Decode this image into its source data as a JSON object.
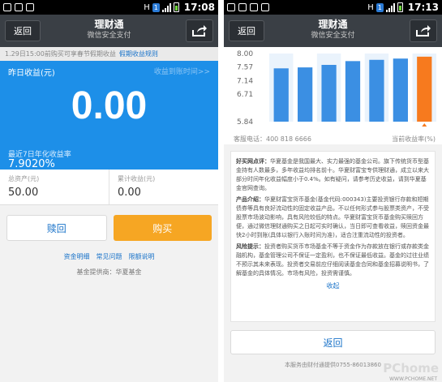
{
  "left": {
    "status": {
      "time": "17:08",
      "net": "H"
    },
    "nav": {
      "back_label": "返回",
      "title": "理财通",
      "subtitle": "微信安全支付"
    },
    "notice": {
      "text": "1.29日15:00前购买可享春节假期收益",
      "link": "假期收益规则"
    },
    "earnings": {
      "yesterday_label": "昨日收益(元)",
      "history_link": "收益到账时间>>",
      "yesterday_value": "0.00",
      "rate_label": "最近7日年化收益率",
      "rate_value": "7.9020%"
    },
    "assets": [
      {
        "label": "总资产(元)",
        "value": "50.00"
      },
      {
        "label": "累计收益(元)",
        "value": "0.00"
      }
    ],
    "buttons": {
      "redeem": "赎回",
      "buy": "购买"
    },
    "links": [
      "资金明细",
      "常见问题",
      "限额说明"
    ],
    "provider": "基金提供商：华夏基金"
  },
  "right": {
    "status": {
      "time": "17:13",
      "net": "H"
    },
    "nav": {
      "back_label": "返回",
      "title": "理财通",
      "subtitle": "微信安全支付"
    },
    "chart_data": {
      "type": "bar",
      "categories": [
        "",
        "",
        "",
        "",
        "",
        "",
        ""
      ],
      "values": [
        7.53,
        7.56,
        7.64,
        7.76,
        7.8,
        7.84,
        7.9
      ],
      "ylim": [
        5.84,
        8.0
      ],
      "yticks": [
        "8.00",
        "7.57",
        "7.14",
        "6.71",
        "5.84"
      ],
      "highlight_index": 6,
      "colors": {
        "bar": "#3b8fe3",
        "highlight": "#f77a1e",
        "stripe": "#eaf3fc"
      }
    },
    "chart_footer": {
      "phone": "客服电话：400 818 6666",
      "current": "当前收益率(%)"
    },
    "info": [
      {
        "label": "好买网点评：",
        "text": "华夏基金是我国最大、实力最强的基金公司。旗下传统货币型基金持有人数最多，多年收益均排名前十。华夏财富宝专供理财通，成立以来大部分时间年化收益幅度小于0.4%。如有疑问，请参考历史收益，请到华夏基金官网查询。"
      },
      {
        "label": "产品介绍：",
        "text": "华夏财富宝货币基金(基金代码:000343)主要投资银行存款和短期债券等具有良好流动性的固定收益产品，不以任何形式参与股票类资产，不受股票市场波动影响，具有风险较低的特点。华夏财富宝货币基金购买赎回方便，通过微信理财通购买之日起可实时确认，当日即可查看收益，赎回资金最快2小时到账(具体以银行入账时间为准)，适合注重流动性的投资者。"
      },
      {
        "label": "风险提示：",
        "text": "投资者购买货币市场基金不等于资金作为存款放在银行或存款类金融机构，基金管理公司不保证一定盈利，也不保证最低收益。基金的过往业绩不预示其未来表现。投资者交易前应仔细阅读基金合同和基金招募说明书，了解基金的具体情况。市场有风险，投资需谨慎。"
      }
    ],
    "collapse": "收起",
    "back_button": "返回",
    "service": "本服务由财付通提供0755-86013860",
    "watermark": "PChome",
    "watermark_url": "WWW.PCHOME.NET"
  }
}
